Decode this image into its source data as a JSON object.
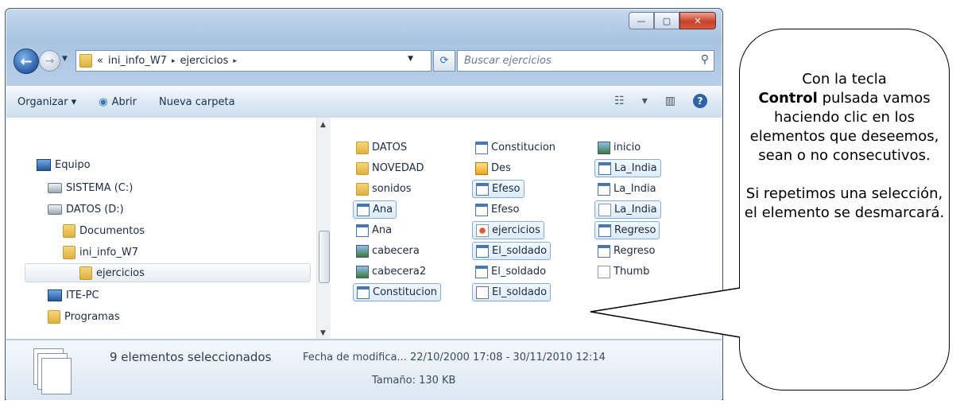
{
  "window": {
    "caption": {
      "minimize": "—",
      "maximize": "▢",
      "close": "✕"
    },
    "address": {
      "root": "«",
      "parts": [
        "ini_info_W7",
        "ejercicios"
      ],
      "separator": "▸"
    },
    "search_placeholder": "Buscar ejercicios"
  },
  "toolbar": {
    "organize": "Organizar ▾",
    "open": "Abrir",
    "new_folder": "Nueva carpeta",
    "views": "▾"
  },
  "tree": [
    {
      "label": "Equipo",
      "icon": "computer-icon"
    },
    {
      "label": "SISTEMA (C:)",
      "icon": "drive-icon"
    },
    {
      "label": "DATOS (D:)",
      "icon": "drive-icon"
    },
    {
      "label": "Documentos",
      "icon": "folder-icon"
    },
    {
      "label": "ini_info_W7",
      "icon": "folder-icon"
    },
    {
      "label": "ejercicios",
      "icon": "folder-icon",
      "selected": true
    },
    {
      "label": "ITE-PC",
      "icon": "network-computer-icon"
    },
    {
      "label": "Programas",
      "icon": "folder-icon"
    }
  ],
  "files": {
    "col1": [
      {
        "label": "DATOS",
        "icon": "folder",
        "selected": false
      },
      {
        "label": "NOVEDAD",
        "icon": "folder",
        "selected": false
      },
      {
        "label": "sonidos",
        "icon": "folder",
        "selected": false
      },
      {
        "label": "Ana",
        "icon": "doc",
        "selected": true
      },
      {
        "label": "Ana",
        "icon": "doc",
        "selected": false
      },
      {
        "label": "cabecera",
        "icon": "img",
        "selected": false
      },
      {
        "label": "cabecera2",
        "icon": "img",
        "selected": false
      },
      {
        "label": "Constitucion",
        "icon": "doc",
        "selected": true
      }
    ],
    "col2": [
      {
        "label": "Constitucion",
        "icon": "doc",
        "selected": false
      },
      {
        "label": "Des",
        "icon": "mp3",
        "selected": false
      },
      {
        "label": "Efeso",
        "icon": "doc",
        "selected": true
      },
      {
        "label": "Efeso",
        "icon": "doc",
        "selected": false
      },
      {
        "label": "ejercicios",
        "icon": "html",
        "selected": true
      },
      {
        "label": "El_soldado",
        "icon": "doc",
        "selected": true
      },
      {
        "label": "El_soldado",
        "icon": "doc",
        "selected": false
      },
      {
        "label": "El_soldado",
        "icon": "db",
        "selected": true
      }
    ],
    "col3": [
      {
        "label": "inicio",
        "icon": "img",
        "selected": false
      },
      {
        "label": "La_India",
        "icon": "doc",
        "selected": true
      },
      {
        "label": "La_India",
        "icon": "doc",
        "selected": false
      },
      {
        "label": "La_India",
        "icon": "txt",
        "selected": true
      },
      {
        "label": "Regreso",
        "icon": "doc",
        "selected": true
      },
      {
        "label": "Regreso",
        "icon": "doc",
        "selected": false
      },
      {
        "label": "Thumb",
        "icon": "txt",
        "selected": false
      }
    ]
  },
  "status": {
    "count": "9 elementos seleccionados",
    "modified": "Fecha de modifica... 22/10/2000 17:08 - 30/11/2010 12:14",
    "size": "Tamaño: 130 KB"
  },
  "callout": {
    "p1_before": "Con la tecla",
    "p1_bold": "Control",
    "p1_after": "pulsada vamos haciendo clic en  los elementos que deseemos, sean o no consecutivos.",
    "p2": "Si repetimos una selección, el elemento se desmarcará."
  }
}
